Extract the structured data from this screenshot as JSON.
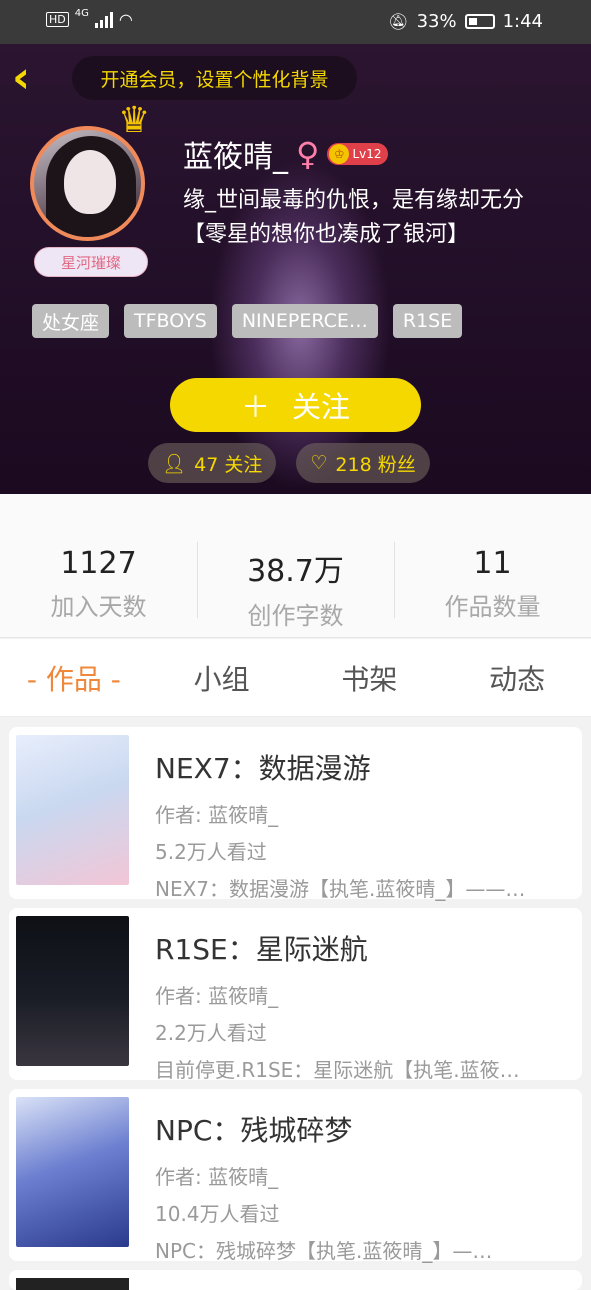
{
  "status_bar": {
    "left_icons": [
      "hd-icon",
      "4g-icon",
      "signal-icon",
      "wifi-icon"
    ],
    "battery": "33%",
    "time": "1:44"
  },
  "header": {
    "vip_prompt": "开通会员，设置个性化背景",
    "avatar_tag": "星河璀璨",
    "username": "蓝筱晴_",
    "gender_symbol": "♀",
    "level": "Lv12",
    "signature_line1": "缘_世间最毒的仇恨，是有缘却无分",
    "signature_line2": "【零星的想你也凑成了银河】",
    "tags": [
      "处女座",
      "TFBOYS",
      "NINEPERCE…",
      "R1SE"
    ],
    "follow_button": "关注",
    "following_label": "47 关注",
    "fans_label": "218 粉丝"
  },
  "stats": [
    {
      "value": "1127",
      "label": "加入天数"
    },
    {
      "value": "38.7万",
      "label": "创作字数"
    },
    {
      "value": "11",
      "label": "作品数量"
    }
  ],
  "tabs": [
    {
      "label": "- 作品 -",
      "active": true
    },
    {
      "label": "小组",
      "active": false
    },
    {
      "label": "书架",
      "active": false
    },
    {
      "label": "动态",
      "active": false
    }
  ],
  "works": [
    {
      "title": "NEX7：数据漫游",
      "author": "作者: 蓝筱晴_",
      "views": "5.2万人看过",
      "summary": "NEX7：数据漫游【执笔.蓝筱晴_】——…",
      "cover_color": "#c9d8f0"
    },
    {
      "title": "R1SE：星际迷航",
      "author": "作者: 蓝筱晴_",
      "views": "2.2万人看过",
      "summary": "目前停更.R1SE：星际迷航【执笔.蓝筱…",
      "cover_color": "#14161c"
    },
    {
      "title": "NPC：残城碎梦",
      "author": "作者: 蓝筱晴_",
      "views": "10.4万人看过",
      "summary": "NPC：残城碎梦【执笔.蓝筱晴_】—…",
      "cover_color": "#3b4fa8"
    }
  ],
  "colors": {
    "accent_yellow": "#f5d800",
    "active_tab": "#f0883c"
  }
}
